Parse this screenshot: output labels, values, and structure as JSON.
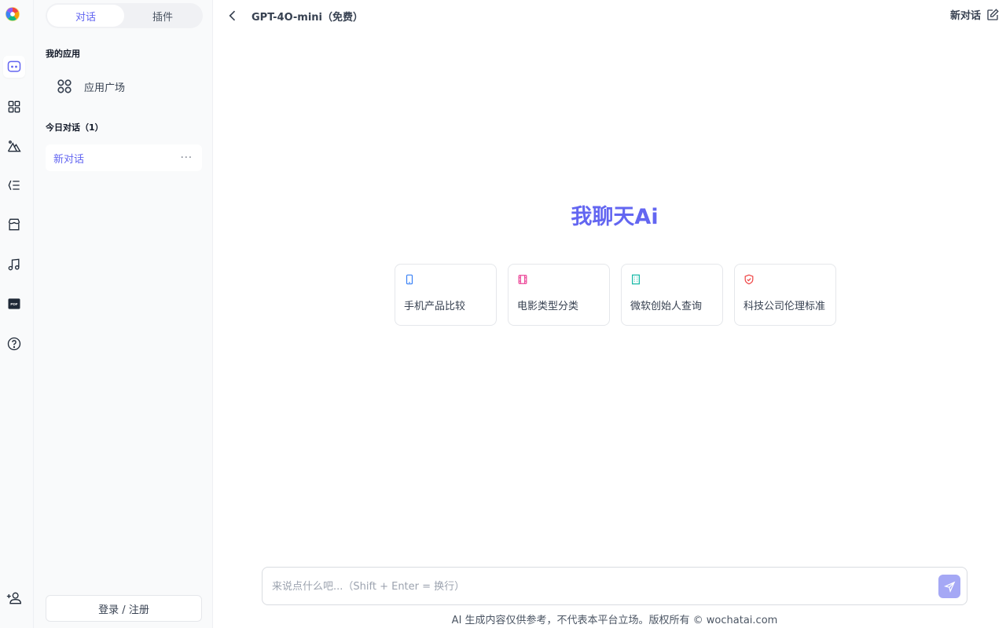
{
  "sidebar": {
    "tabs": [
      {
        "label": "对话"
      },
      {
        "label": "插件"
      }
    ],
    "my_apps_label": "我的应用",
    "app_plaza_label": "应用广场",
    "today_label": "今日对话（1）",
    "conversations": [
      {
        "label": "新对话",
        "more": "···"
      }
    ],
    "login_label": "登录 / 注册"
  },
  "rail_icons": [
    "chat-icon",
    "grid-icon",
    "image-icon",
    "mindmap-icon",
    "store-icon",
    "music-icon",
    "pdf-icon",
    "help-icon",
    "user-plus-icon"
  ],
  "header": {
    "model": "GPT-4O-mini（免费）",
    "new_chat": "新对话"
  },
  "main": {
    "hero_title": "我聊天Ai",
    "suggestions": [
      {
        "icon": "phone-icon",
        "label": "手机产品比较",
        "color": "#3b82f6"
      },
      {
        "icon": "film-icon",
        "label": "电影类型分类",
        "color": "#ec4899"
      },
      {
        "icon": "building-icon",
        "label": "微软创始人查询",
        "color": "#14b8a6"
      },
      {
        "icon": "shield-icon",
        "label": "科技公司伦理标准",
        "color": "#ef4444"
      }
    ]
  },
  "input": {
    "placeholder": "来说点什么吧...（Shift + Enter = 换行）"
  },
  "footer": {
    "text": "AI 生成内容仅供参考，不代表本平台立场。版权所有 © wochatai.com"
  },
  "colors": {
    "accent": "#6366f1",
    "send": "#a5a8f5"
  }
}
